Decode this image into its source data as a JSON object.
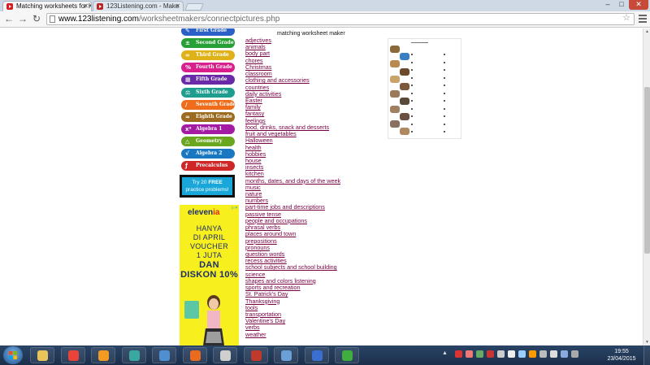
{
  "browser": {
    "tabs": [
      {
        "title": "Matching worksheets for K",
        "active": true
      },
      {
        "title": "123Listening.com - Make",
        "active": false
      }
    ],
    "url_host": "www.123listening.com",
    "url_path": "/worksheetmakers/connectpictures.php",
    "window_controls": {
      "minimize": "–",
      "maximize": "□",
      "close": "✕"
    },
    "nav": {
      "back": "←",
      "forward": "→",
      "reload": "↻"
    }
  },
  "sidebar": {
    "grades": [
      {
        "label": "First Grade",
        "color": "#2a60c8",
        "icon": "pencil-icon",
        "glyph": "✎"
      },
      {
        "label": "Second Grade",
        "color": "#27a035",
        "icon": "plus-minus-icon",
        "glyph": "±"
      },
      {
        "label": "Third Grade",
        "color": "#e0b21a",
        "icon": "infinity-icon",
        "glyph": "∞"
      },
      {
        "label": "Fourth Grade",
        "color": "#d91f8c",
        "icon": "percent-icon",
        "glyph": "%"
      },
      {
        "label": "Fifth Grade",
        "color": "#6a2aa8",
        "icon": "grid-icon",
        "glyph": "▦"
      },
      {
        "label": "Sixth Grade",
        "color": "#1f9e8f",
        "icon": "scale-icon",
        "glyph": "⚖"
      },
      {
        "label": "Seventh Grade",
        "color": "#ef6d1a",
        "icon": "ruler-icon",
        "glyph": "∕"
      },
      {
        "label": "Eighth Grade",
        "color": "#9c6b20",
        "icon": "wave-icon",
        "glyph": "≈"
      },
      {
        "label": "Algebra 1",
        "color": "#a31ba3",
        "icon": "x-squared-icon",
        "glyph": "x²"
      },
      {
        "label": "Geometry",
        "color": "#6aa71f",
        "icon": "triangle-icon",
        "glyph": "△"
      },
      {
        "label": "Algebra 2",
        "color": "#1a78c2",
        "icon": "sqrt-icon",
        "glyph": "√"
      },
      {
        "label": "Precalculus",
        "color": "#cf2727",
        "icon": "function-icon",
        "glyph": "ƒ"
      }
    ],
    "promo": {
      "line1_prefix": "Try 20 ",
      "line1_bold": "FREE",
      "line2": "practice problems!"
    },
    "ad": {
      "logo": "eleven",
      "logo_accent": "ia",
      "lines": [
        "HANYA",
        "DI APRIL",
        "VOUCHER",
        "1 JUTA"
      ],
      "bold_lines": [
        "DAN",
        "DISKON 10%"
      ],
      "colors": {
        "bg": "#f7ef1e",
        "text": "#1d2e6d"
      }
    }
  },
  "main": {
    "title": "matching worksheet maker",
    "topics": [
      "adjectives",
      "animals",
      "body part",
      "chores",
      "Christmas",
      "classroom",
      "clothing and accessories",
      "countries",
      "daily activities",
      "Easter",
      "family",
      "fantasy",
      "feelings",
      "food, drinks, snack and desserts",
      "fruit and vegetables",
      "Halloween",
      "health",
      "hobbies",
      "house",
      "insects",
      "kitchen",
      "months, dates, and days of the week",
      "music",
      "nature",
      "numbers",
      "part-time jobs and descriptions",
      "passive tense",
      "people and occupations",
      "phrasal verbs",
      "places around town",
      "prepositions",
      "pronouns",
      "question words",
      "recess activities",
      "school subjects and school building",
      "science",
      "shapes and colors listening",
      "sports and recreation",
      "St. Patrick's Day",
      "Thanksgiving",
      "tools",
      "transportation",
      "Valentine's Day",
      "verbs",
      "weather"
    ],
    "link_color": "#770044"
  },
  "taskbar": {
    "clock_time": "19:55",
    "clock_date": "23/04/2015",
    "apps": [
      {
        "icon": "file-explorer-icon",
        "color": "#e8c45a"
      },
      {
        "icon": "chrome-icon",
        "color": "#e9443a"
      },
      {
        "icon": "media-player-icon",
        "color": "#f29a21"
      },
      {
        "icon": "editor-icon",
        "color": "#3aa7a0"
      },
      {
        "icon": "network-icon",
        "color": "#4f8fd0"
      },
      {
        "icon": "firefox-icon",
        "color": "#e86b1f"
      },
      {
        "icon": "calculator-icon",
        "color": "#cfcfcf"
      },
      {
        "icon": "book-icon",
        "color": "#c0392b"
      },
      {
        "icon": "paint-icon",
        "color": "#6a9fd8"
      },
      {
        "icon": "3c-icon",
        "color": "#3a6fd1"
      },
      {
        "icon": "green-app-icon",
        "color": "#3fae3f"
      }
    ]
  }
}
